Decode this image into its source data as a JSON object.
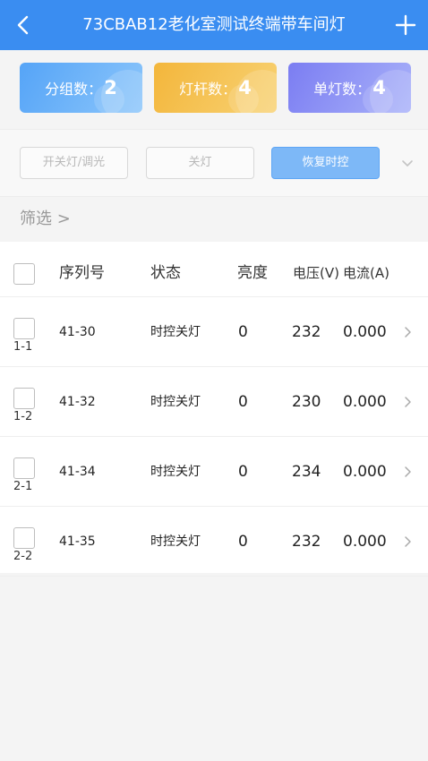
{
  "header": {
    "title": "73CBAB12老化室测试终端带车间灯",
    "back_icon": "chevron-left-icon",
    "add_icon": "plus-icon"
  },
  "stats": [
    {
      "label": "分组数：",
      "value": "2"
    },
    {
      "label": "灯杆数：",
      "value": "4"
    },
    {
      "label": "单灯数：",
      "value": "4"
    }
  ],
  "controls": {
    "switch_dim": "开关灯/调光",
    "off": "关灯",
    "restore": "恢复时控",
    "expand_icon": "chevron-down-icon"
  },
  "filter": {
    "label": "筛选 >"
  },
  "table": {
    "columns": [
      "序列号",
      "状态",
      "亮度",
      "电压(V)",
      "电流(A)"
    ],
    "rows": [
      {
        "group": "1-1",
        "serial": "41-30",
        "status": "时控关灯",
        "brightness": "0",
        "voltage": "232",
        "current": "0.000"
      },
      {
        "group": "1-2",
        "serial": "41-32",
        "status": "时控关灯",
        "brightness": "0",
        "voltage": "230",
        "current": "0.000"
      },
      {
        "group": "2-1",
        "serial": "41-34",
        "status": "时控关灯",
        "brightness": "0",
        "voltage": "234",
        "current": "0.000"
      },
      {
        "group": "2-2",
        "serial": "41-35",
        "status": "时控关灯",
        "brightness": "0",
        "voltage": "232",
        "current": "0.000"
      }
    ]
  },
  "colors": {
    "primary": "#3a8df1",
    "blue_card": "#55a4f7",
    "orange_card": "#f3b63b",
    "purple_card": "#7b7df2",
    "restore_button": "#7db8f7"
  }
}
